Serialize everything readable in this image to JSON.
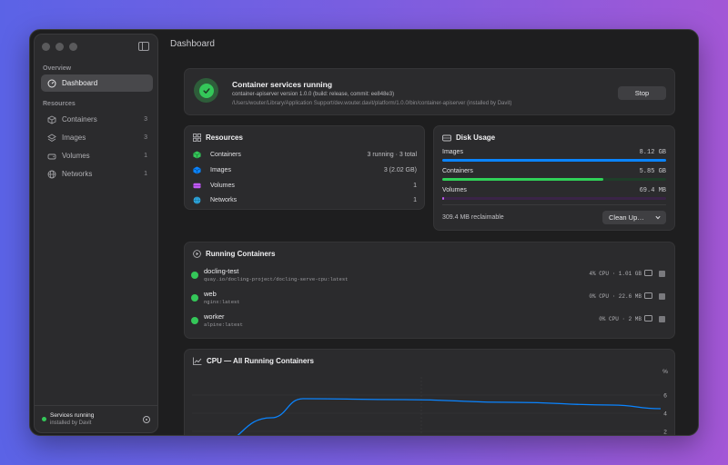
{
  "page": {
    "title": "Dashboard"
  },
  "sidebar": {
    "overview_label": "Overview",
    "resources_label": "Resources",
    "items": [
      {
        "label": "Dashboard",
        "icon": "gauge-icon",
        "count": ""
      },
      {
        "label": "Containers",
        "icon": "cube-icon",
        "count": "3"
      },
      {
        "label": "Images",
        "icon": "layers-icon",
        "count": "3"
      },
      {
        "label": "Volumes",
        "icon": "drive-icon",
        "count": "1"
      },
      {
        "label": "Networks",
        "icon": "globe-icon",
        "count": "1"
      }
    ],
    "footer": {
      "title": "Services running",
      "subtitle": "installed by Davit"
    }
  },
  "hero": {
    "title": "Container services running",
    "version": "container-apiserver version 1.0.0 (build: release, commit: ee848e3)",
    "path": "/Users/wouter/Library/Application Support/dev.wouter.davit/platform/1.0.0/bin/container-apiserver (installed by Davit)",
    "stop_label": "Stop"
  },
  "resources": {
    "title": "Resources",
    "rows": [
      {
        "label": "Containers",
        "value": "3 running · 3 total",
        "color": "#34c759"
      },
      {
        "label": "Images",
        "value": "3 (2.02 GB)",
        "color": "#0a84ff"
      },
      {
        "label": "Volumes",
        "value": "1",
        "color": "#bf5af2"
      },
      {
        "label": "Networks",
        "value": "1",
        "color": "#32ade6"
      }
    ]
  },
  "disk": {
    "title": "Disk Usage",
    "rows": [
      {
        "label": "Images",
        "value": "8.12 GB",
        "fill": 1.0,
        "color": "#0a84ff"
      },
      {
        "label": "Containers",
        "value": "5.85 GB",
        "fill": 0.72,
        "color": "#30d158"
      },
      {
        "label": "Volumes",
        "value": "69.4 MB",
        "fill": 0.01,
        "color": "#bf5af2"
      }
    ],
    "reclaimable": "309.4 MB reclaimable",
    "cleanup_label": "Clean Up…"
  },
  "running": {
    "title": "Running Containers",
    "rows": [
      {
        "name": "docling-test",
        "image": "quay.io/docling-project/docling-serve-cpu:latest",
        "stats": "4% CPU · 1.01 GB"
      },
      {
        "name": "web",
        "image": "nginx:latest",
        "stats": "0% CPU · 22.6 MB"
      },
      {
        "name": "worker",
        "image": "alpine:latest",
        "stats": "0% CPU · 2 MB"
      }
    ]
  },
  "cpu_chart": {
    "title": "CPU — All Running Containers",
    "unit": "%",
    "ticks": [
      "6",
      "4",
      "2"
    ]
  },
  "chart_data": {
    "type": "line",
    "title": "CPU — All Running Containers",
    "ylabel": "%",
    "ylim": [
      0,
      8
    ],
    "series": [
      {
        "values": [
          0.4,
          3.5,
          5.6,
          5.5,
          5.2,
          4.9,
          4.5
        ]
      }
    ],
    "color": "#0a84ff"
  }
}
